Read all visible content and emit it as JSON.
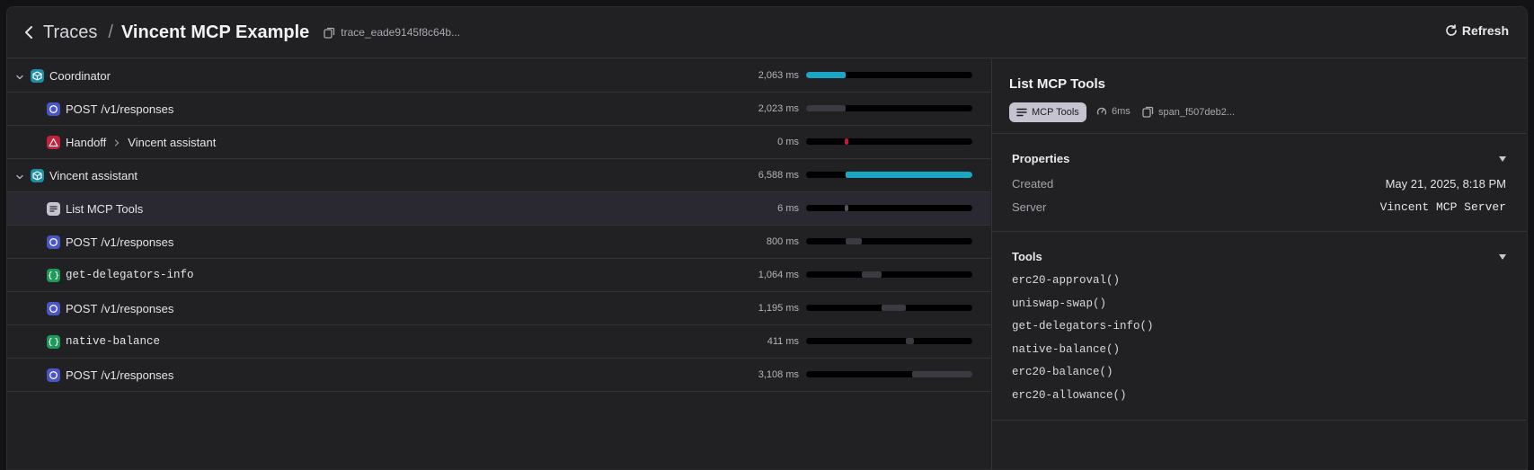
{
  "header": {
    "back_icon": "chevron-left-icon",
    "breadcrumb": "Traces",
    "separator": "/",
    "title": "Vincent MCP Example",
    "trace_id": "trace_eade9145f8c64b...",
    "refresh_label": "Refresh"
  },
  "spans": [
    {
      "label": "Coordinator",
      "label2": "",
      "icon": "agent-icon",
      "duration": "2,063 ms",
      "collapsible": true,
      "indent": 0,
      "mono": false,
      "color": "#1aa6c4",
      "start": 0.0,
      "end": 0.24
    },
    {
      "label": "POST",
      "label2": "/v1/responses",
      "icon": "response-icon",
      "duration": "2,023 ms",
      "collapsible": false,
      "indent": 1,
      "mono": false,
      "color": "#3a3a42",
      "start": 0.0,
      "end": 0.24
    },
    {
      "label": "Handoff",
      "label2": "Vincent assistant",
      "icon": "handoff-icon",
      "duration": "0 ms",
      "collapsible": false,
      "indent": 1,
      "mono": false,
      "color": "#c21a3a",
      "start": 0.235,
      "end": 0.255
    },
    {
      "label": "Vincent assistant",
      "label2": "",
      "icon": "agent-icon",
      "duration": "6,588 ms",
      "collapsible": true,
      "indent": 0,
      "mono": false,
      "color": "#1aa6c4",
      "start": 0.24,
      "end": 1.0
    },
    {
      "label": "List MCP Tools",
      "label2": "",
      "icon": "list-icon",
      "duration": "6 ms",
      "collapsible": false,
      "indent": 1,
      "mono": false,
      "color": "#55555e",
      "start": 0.235,
      "end": 0.25,
      "selected": true
    },
    {
      "label": "POST",
      "label2": "/v1/responses",
      "icon": "response-icon",
      "duration": "800 ms",
      "collapsible": false,
      "indent": 1,
      "mono": false,
      "color": "#3a3a42",
      "start": 0.24,
      "end": 0.335
    },
    {
      "label": "get-delegators-info",
      "label2": "",
      "icon": "function-icon",
      "duration": "1,064 ms",
      "collapsible": false,
      "indent": 1,
      "mono": true,
      "color": "#3a3a42",
      "start": 0.335,
      "end": 0.455
    },
    {
      "label": "POST",
      "label2": "/v1/responses",
      "icon": "response-icon",
      "duration": "1,195 ms",
      "collapsible": false,
      "indent": 1,
      "mono": false,
      "color": "#3a3a42",
      "start": 0.455,
      "end": 0.6
    },
    {
      "label": "native-balance",
      "label2": "",
      "icon": "function-icon",
      "duration": "411 ms",
      "collapsible": false,
      "indent": 1,
      "mono": true,
      "color": "#3a3a42",
      "start": 0.6,
      "end": 0.65
    },
    {
      "label": "POST",
      "label2": "/v1/responses",
      "icon": "response-icon",
      "duration": "3,108 ms",
      "collapsible": false,
      "indent": 1,
      "mono": false,
      "color": "#3a3a42",
      "start": 0.64,
      "end": 1.0
    }
  ],
  "detail": {
    "title": "List MCP Tools",
    "chip": "MCP Tools",
    "duration": "6ms",
    "span_id": "span_f507deb2...",
    "properties": {
      "title": "Properties",
      "created_label": "Created",
      "created_value": "May 21, 2025, 8:18 PM",
      "server_label": "Server",
      "server_value": "Vincent MCP Server"
    },
    "tools": {
      "title": "Tools",
      "items": [
        "erc20-approval()",
        "uniswap-swap()",
        "get-delegators-info()",
        "native-balance()",
        "erc20-balance()",
        "erc20-allowance()"
      ]
    }
  },
  "colors": {
    "agent": "#1b8fa8",
    "response": "#4a55c8",
    "handoff": "#c4223c",
    "list": "#c6c3d1",
    "function": "#1f9a5a"
  }
}
